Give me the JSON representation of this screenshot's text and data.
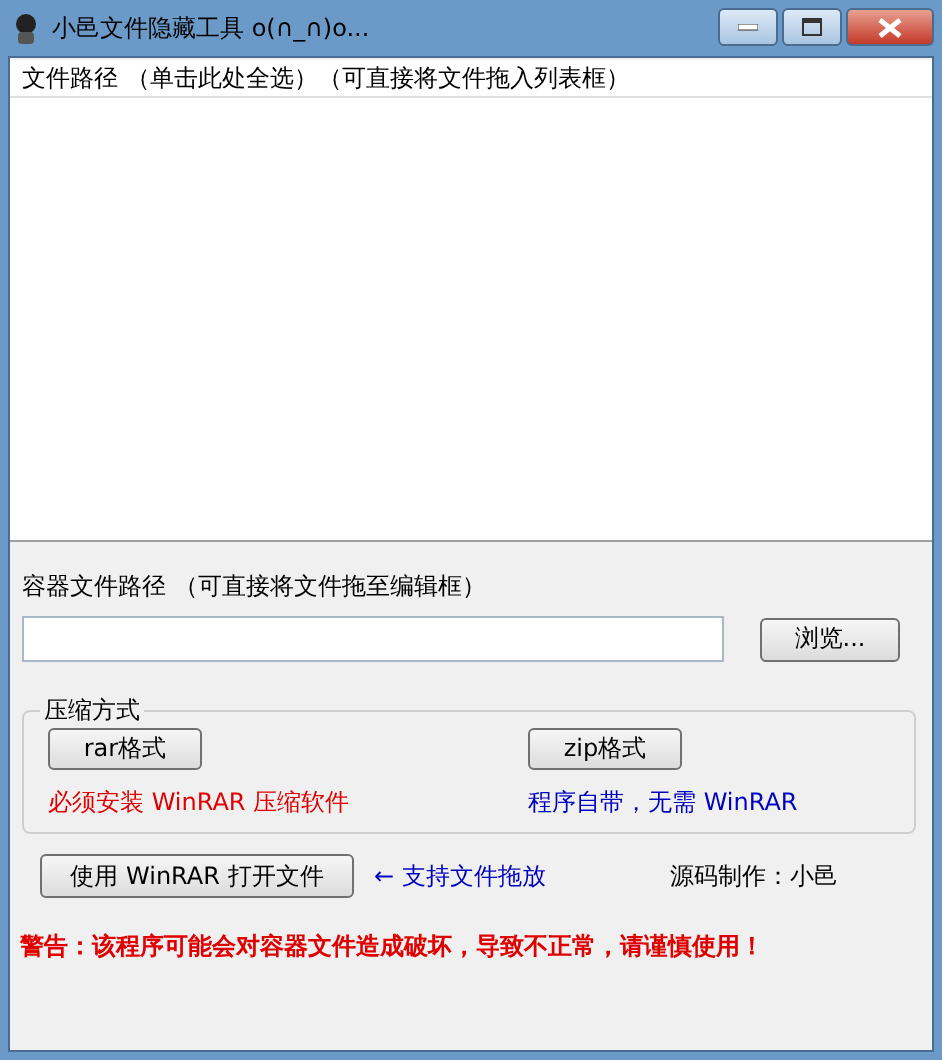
{
  "window": {
    "title": "小邑文件隐藏工具 o(∩_∩)o..."
  },
  "file_list": {
    "header": "文件路径  （单击此处全选）（可直接将文件拖入列表框）"
  },
  "container": {
    "label": "容器文件路径   （可直接将文件拖至编辑框）",
    "browse_button": "浏览..."
  },
  "compression": {
    "legend": "压缩方式",
    "options": [
      {
        "button": "rar格式",
        "note": "必须安装 WinRAR 压缩软件",
        "color": "#e00000"
      },
      {
        "button": "zip格式",
        "note": "程序自带，无需 WinRAR",
        "color": "#0000c0"
      }
    ]
  },
  "open_button": "使用 WinRAR 打开文件",
  "drag_hint": "← 支持文件拖放",
  "credit": "源码制作：小邑",
  "warning": "警告：该程序可能会对容器文件造成破坏，导致不正常，请谨慎使用！"
}
